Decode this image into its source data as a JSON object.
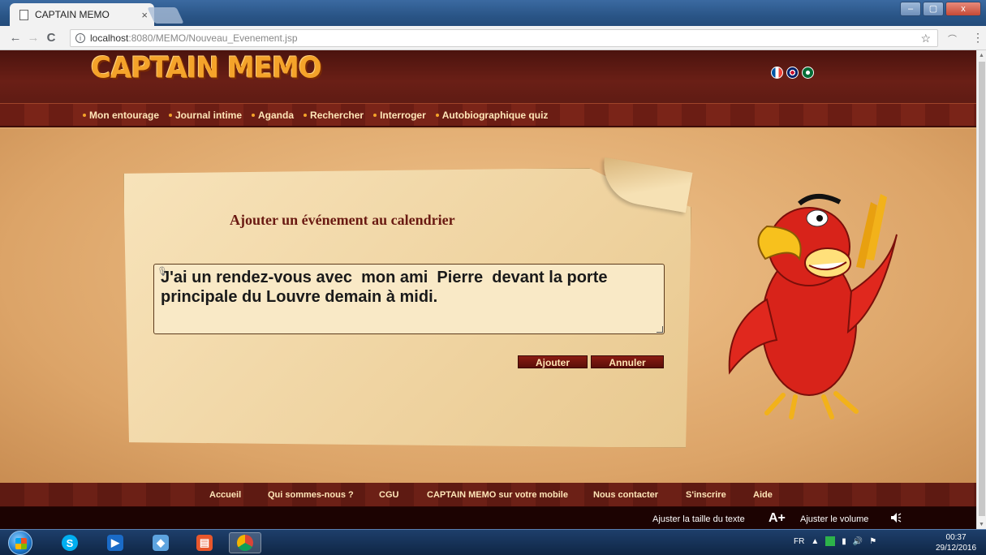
{
  "browser": {
    "tab_title": "CAPTAIN MEMO",
    "tab_close": "×",
    "url_host": "localhost",
    "url_rest": ":8080/MEMO/Nouveau_Evenement.jsp",
    "min_glyph": "–",
    "max_glyph": "▢",
    "close_glyph": "x",
    "info_glyph": "i",
    "star_glyph": "☆",
    "menu_glyph": "⋮",
    "back_glyph": "←",
    "forward_glyph": "→",
    "reload_glyph": "C"
  },
  "site": {
    "logo": "CAPTAIN MEMO",
    "flags": [
      "fr",
      "uk",
      "ar"
    ]
  },
  "nav": {
    "items": [
      "Mon entourage",
      "Journal intime",
      "Aganda",
      "Rechercher",
      "Interroger",
      "Autobiographique quiz"
    ]
  },
  "form": {
    "title": "Ajouter un événement au calendrier",
    "text": "J'ai un rendez-vous avec  mon ami  Pierre  devant la porte principale du Louvre demain à midi.",
    "submit_label": "Ajouter",
    "cancel_label": "Annuler"
  },
  "footer": {
    "links": [
      "Accueil",
      "Qui sommes-nous ?",
      "CGU",
      "CAPTAIN MEMO sur votre mobile",
      "Nous contacter",
      "S'inscrire",
      "Aide"
    ],
    "text_size_label": "Ajuster la taille du texte",
    "text_size_icon": "A+",
    "volume_label": "Ajuster le volume"
  },
  "taskbar": {
    "lang": "FR",
    "time": "00:37",
    "date": "29/12/2016",
    "apps": [
      "skype-icon",
      "media-player-icon",
      "virtualbox-icon",
      "office-icon",
      "chrome-icon"
    ]
  },
  "colors": {
    "header_red": "#6a1f16",
    "logo_orange": "#f4a32a",
    "button_red": "#8a1b12",
    "parchment": "#f7e3ba"
  }
}
